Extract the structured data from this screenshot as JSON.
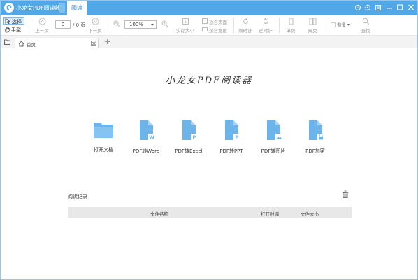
{
  "app": {
    "title": "小龙女PDF阅读器",
    "menu_tab": "阅读",
    "accent": "#52a8e6"
  },
  "toolbar": {
    "select_label": "选择",
    "hand_label": "手型",
    "prev_page": "上一页",
    "page_current": "0",
    "page_total": "/ 0 页",
    "next_page": "下一页",
    "zoom_value": "100%",
    "actual_size": "实际大小",
    "fit_page": "适合页面",
    "fit_width": "适合宽度",
    "rotate_ccw": "顺时针",
    "rotate_cw": "逆时针",
    "single_page": "单页",
    "double_page": "双页",
    "background": "背景",
    "search": "查找"
  },
  "tabs": {
    "home": "首页",
    "add": "+"
  },
  "main": {
    "brand": "小龙女PDF阅读器",
    "actions": [
      {
        "label": "打开文档",
        "icon": "folder-icon"
      },
      {
        "label": "PDF转Word",
        "icon": "pdf-to-word-icon",
        "badge": "W"
      },
      {
        "label": "PDF转Excel",
        "icon": "pdf-to-excel-icon",
        "badge": "P"
      },
      {
        "label": "PDF转PPT",
        "icon": "pdf-to-ppt-icon",
        "badge": "P"
      },
      {
        "label": "PDF转图片",
        "icon": "pdf-to-image-icon"
      },
      {
        "label": "PDF加密",
        "icon": "pdf-encrypt-icon"
      }
    ],
    "icon_color": "#6cb4ea"
  },
  "history": {
    "title": "阅读记录",
    "columns": [
      "文件名称",
      "打开时间",
      "文件大小"
    ]
  }
}
